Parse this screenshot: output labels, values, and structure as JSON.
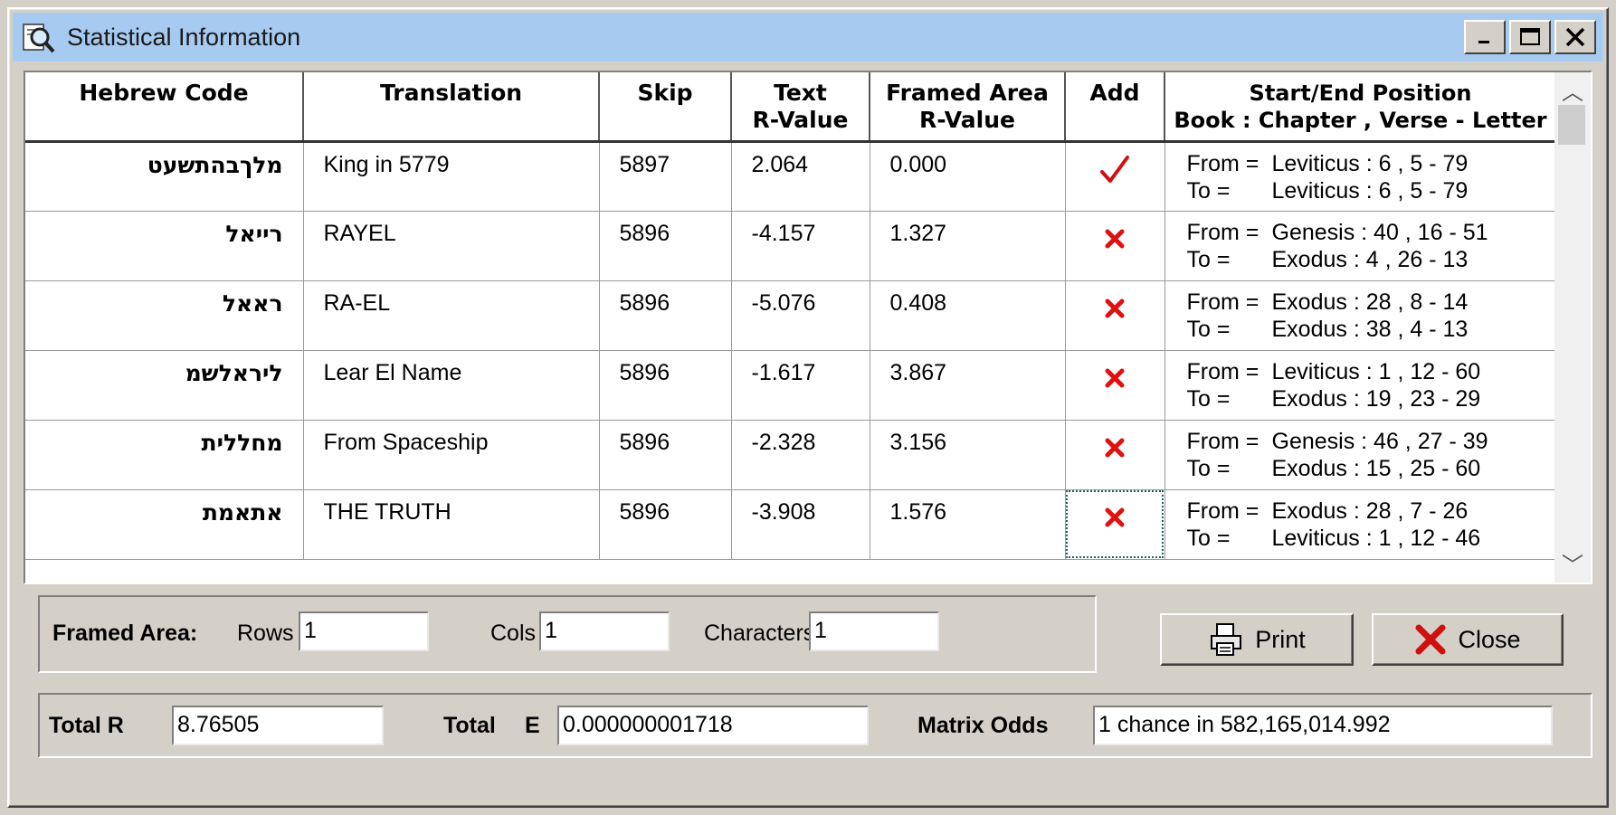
{
  "window": {
    "title": "Statistical Information",
    "icon": "magnifier-document-icon"
  },
  "table": {
    "headers": {
      "hebrew": "Hebrew Code",
      "translation": "Translation",
      "skip": "Skip",
      "text_r_1": "Text",
      "text_r_2": "R-Value",
      "framed_r_1": "Framed Area",
      "framed_r_2": "R-Value",
      "add": "Add",
      "pos_1": "Start/End Position",
      "pos_2": "Book : Chapter , Verse - Letter"
    },
    "rows": [
      {
        "hebrew": "מלךבהתשעט",
        "translation": "King in 5779",
        "skip": "5897",
        "text_r": "2.064",
        "framed_r": "0.000",
        "add": "check",
        "from_label": "From =",
        "from": "Leviticus : 6 , 5 - 79",
        "to_label": "To =",
        "to": "Leviticus : 6 , 5 - 79"
      },
      {
        "hebrew": "רייאל",
        "translation": "RAYEL",
        "skip": "5896",
        "text_r": "-4.157",
        "framed_r": "1.327",
        "add": "x",
        "from_label": "From =",
        "from": "Genesis : 40 , 16 - 51",
        "to_label": "To =",
        "to": "Exodus : 4 , 26 - 13"
      },
      {
        "hebrew": "ראאל",
        "translation": "RA-EL",
        "skip": "5896",
        "text_r": "-5.076",
        "framed_r": "0.408",
        "add": "x",
        "from_label": "From =",
        "from": "Exodus : 28 , 8 - 14",
        "to_label": "To =",
        "to": "Exodus : 38 , 4 - 13"
      },
      {
        "hebrew": "ליראלשמ",
        "translation": "Lear El Name",
        "skip": "5896",
        "text_r": "-1.617",
        "framed_r": "3.867",
        "add": "x",
        "from_label": "From =",
        "from": "Leviticus : 1 , 12 - 60",
        "to_label": "To =",
        "to": "Exodus : 19 , 23 - 29"
      },
      {
        "hebrew": "מחללית",
        "translation": "From Spaceship",
        "skip": "5896",
        "text_r": "-2.328",
        "framed_r": "3.156",
        "add": "x",
        "from_label": "From =",
        "from": "Genesis : 46 , 27 - 39",
        "to_label": "To =",
        "to": "Exodus : 15 , 25 - 60"
      },
      {
        "hebrew": "אתאמת",
        "translation": "THE TRUTH",
        "skip": "5896",
        "text_r": "-3.908",
        "framed_r": "1.576",
        "add": "x",
        "from_label": "From =",
        "from": "Exodus : 28 , 7 - 26",
        "to_label": "To =",
        "to": "Leviticus : 1 , 12 - 46"
      }
    ]
  },
  "framed_area": {
    "label": "Framed Area:",
    "rows_label": "Rows",
    "rows_value": "1",
    "cols_label": "Cols",
    "cols_value": "1",
    "chars_label": "Characters",
    "chars_value": "1"
  },
  "buttons": {
    "print_label": "Print",
    "close_label": "Close"
  },
  "totals": {
    "total_r_label": "Total R",
    "total_r_value": "8.76505",
    "total_e_label": "Total",
    "total_e_letter": "E",
    "total_e_value": "0.000000001718",
    "odds_label": "Matrix Odds",
    "odds_value": "1 chance in 582,165,014.992"
  },
  "colors": {
    "check": "#d01010",
    "x_mark": "#e01010",
    "title_bg": "#a6caf0"
  }
}
